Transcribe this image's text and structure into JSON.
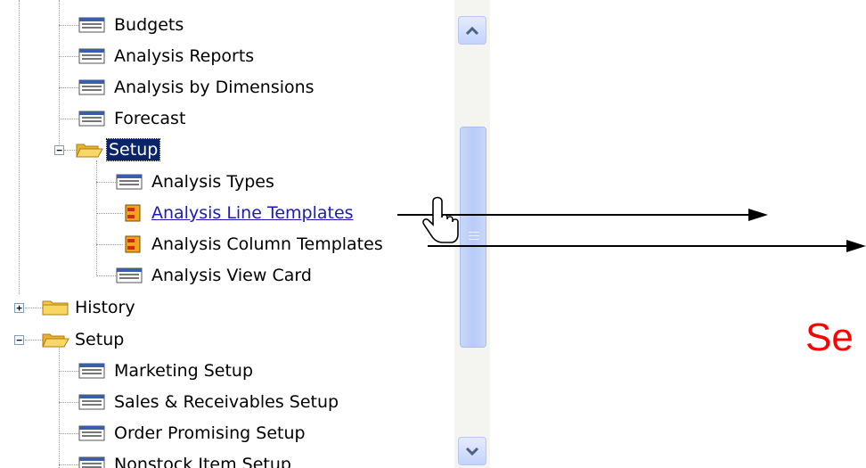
{
  "tree": {
    "items": [
      {
        "label": "Budgets",
        "icon": "form-icon"
      },
      {
        "label": "Analysis Reports",
        "icon": "form-icon"
      },
      {
        "label": "Analysis by Dimensions",
        "icon": "form-icon"
      },
      {
        "label": "Forecast",
        "icon": "form-icon"
      },
      {
        "label": "Setup",
        "icon": "open-folder-icon",
        "expander": "−",
        "selected": true
      },
      {
        "label": "Analysis Types",
        "icon": "form-icon"
      },
      {
        "label": "Analysis Line Templates",
        "icon": "task-icon",
        "hovered": true
      },
      {
        "label": "Analysis Column Templates",
        "icon": "task-icon"
      },
      {
        "label": "Analysis View Card",
        "icon": "form-icon"
      },
      {
        "label": "History",
        "icon": "closed-folder-icon",
        "expander": "+"
      },
      {
        "label": "Setup",
        "icon": "open-folder-icon",
        "expander": "−"
      },
      {
        "label": "Marketing Setup",
        "icon": "form-icon"
      },
      {
        "label": "Sales & Receivables Setup",
        "icon": "form-icon"
      },
      {
        "label": "Order Promising Setup",
        "icon": "form-icon"
      },
      {
        "label": "Nonstock Item Setup",
        "icon": "form-icon"
      }
    ]
  },
  "scrollbar": {
    "up_icon": "chevron-up-icon",
    "down_icon": "chevron-down-icon"
  },
  "annotation": {
    "text": "Se",
    "color": "#ff0000"
  },
  "cursor": {
    "icon": "hand-pointer-icon"
  },
  "colors": {
    "selection": "#0a246a",
    "link": "#1a1ab8",
    "folder": "#f5c842",
    "annotation": "#ff0000"
  }
}
